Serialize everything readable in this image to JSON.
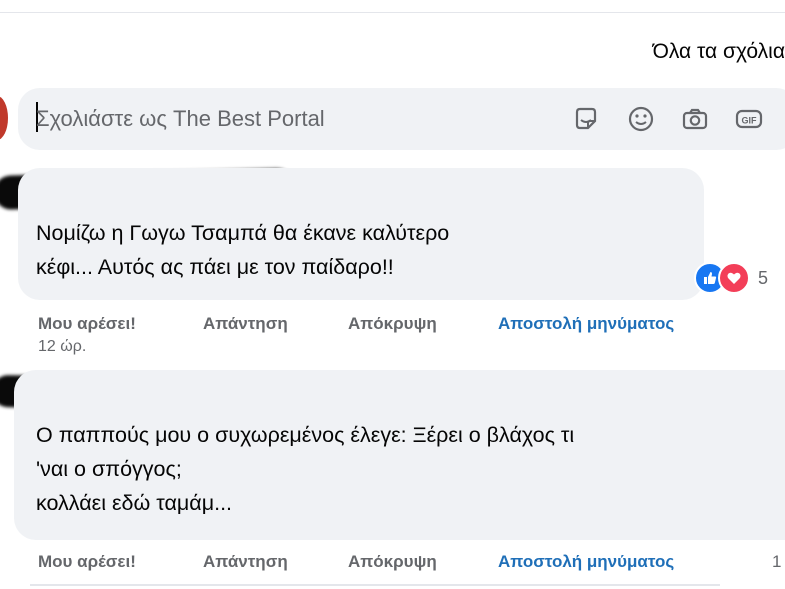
{
  "sort_label": "Όλα τα σχόλια",
  "composer": {
    "placeholder": "Σχολιάστε ως The Best Portal",
    "icons": [
      "sticker-icon",
      "emoji-icon",
      "camera-icon",
      "gif-icon"
    ],
    "gif_label": "GIF"
  },
  "comments": [
    {
      "text_lines": [
        "Νομίζω η Γωγω Τσαμπά θα έκανε καλύτερο",
        "κέφι... Αυτός ας πάει με τον παίδαρο!!"
      ],
      "reactions": {
        "types": [
          "like",
          "love"
        ],
        "count": "5"
      },
      "actions": {
        "like": "Μου αρέσει!",
        "reply": "Απάντηση",
        "hide": "Απόκρυψη",
        "message": "Αποστολή μηνύματος"
      },
      "time": "12 ώρ."
    },
    {
      "text_lines": [
        "Ο παππούς μου ο συχωρεμένος έλεγε: Ξέρει ο βλάχος τι",
        "'ναι ο σπόγγος;",
        "κολλάει εδώ ταμάμ..."
      ],
      "actions": {
        "like": "Μου αρέσει!",
        "reply": "Απάντηση",
        "hide": "Απόκρυψη",
        "message": "Αποστολή μηνύματος"
      },
      "trailing": "1"
    }
  ],
  "colors": {
    "bubble": "#f0f2f5",
    "link_blue": "#1f6fb8",
    "meta_gray": "#65676b",
    "like_blue": "#1877f2",
    "love_red": "#f33e58"
  }
}
